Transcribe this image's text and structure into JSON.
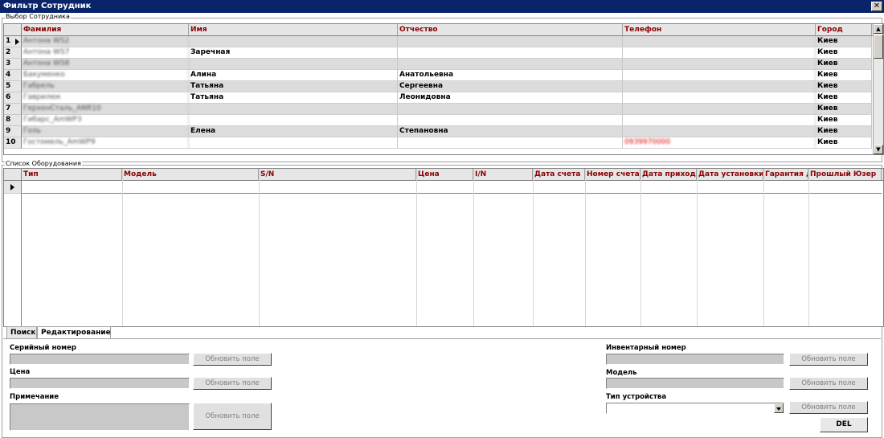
{
  "window": {
    "title": "Фильтр Сотрудник",
    "close_glyph": "✕"
  },
  "employees": {
    "legend": "Выбор Сотрудника",
    "columns": [
      "Фамилия",
      "Имя",
      "Отчество",
      "Телефон",
      "Город"
    ],
    "rows": [
      {
        "num": "1",
        "surname": "Антона WS2",
        "name": "",
        "patronymic": "",
        "phone": "",
        "city": "Киев"
      },
      {
        "num": "2",
        "surname": "Антона WS7",
        "name": "Заречная",
        "patronymic": "",
        "phone": "",
        "city": "Киев"
      },
      {
        "num": "3",
        "surname": "Антона WS8",
        "name": "",
        "patronymic": "",
        "phone": "",
        "city": "Киев"
      },
      {
        "num": "4",
        "surname": "Бакуменко",
        "name": "Алина",
        "patronymic": "Анатольевна",
        "phone": "",
        "city": "Киев"
      },
      {
        "num": "5",
        "surname": "Габрель",
        "name": "Татьяна",
        "patronymic": "Сергеевна",
        "phone": "",
        "city": "Киев"
      },
      {
        "num": "6",
        "surname": "Гаврилюк",
        "name": "Татьяна",
        "patronymic": "Леонидовна",
        "phone": "",
        "city": "Киев"
      },
      {
        "num": "7",
        "surname": "ГерхенСталь_ANR10",
        "name": "",
        "patronymic": "",
        "phone": "",
        "city": "Киев"
      },
      {
        "num": "8",
        "surname": "Гибарс_AmWP3",
        "name": "",
        "patronymic": "",
        "phone": "",
        "city": "Киев"
      },
      {
        "num": "9",
        "surname": "Голь",
        "name": "Елена",
        "patronymic": "Степановна",
        "phone": "",
        "city": "Киев"
      },
      {
        "num": "10",
        "surname": "Гостомель_AmWP9",
        "name": "",
        "patronymic": "",
        "phone": "0939970000",
        "city": "Киев"
      }
    ]
  },
  "equipment": {
    "legend": "Список Оборудования",
    "columns": [
      "Тип",
      "Модель",
      "S/N",
      "Цена",
      "I/N",
      "Дата счета",
      "Номер счета",
      "Дата прихода",
      "Дата установки",
      "Гарантия д",
      "Прошлый Юзер"
    ]
  },
  "tabs": [
    "Поиск",
    "Редактирование"
  ],
  "form": {
    "serial_label": "Серийный номер",
    "price_label": "Цена",
    "note_label": "Примечание",
    "inventory_label": "Инвентарный номер",
    "model_label": "Модель",
    "device_type_label": "Тип устройства",
    "update_label": "Обновить поле",
    "del_label": "DEL"
  }
}
